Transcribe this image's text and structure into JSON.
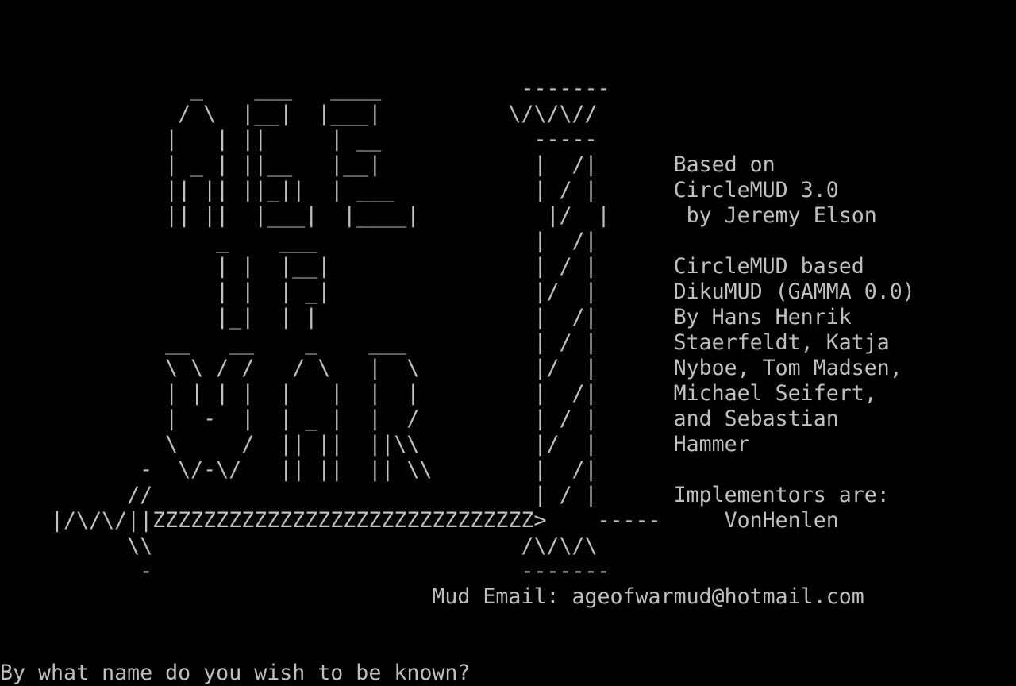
{
  "screen": {
    "background": "#000000",
    "foreground": "#bfbfbf",
    "lines": [
      "",
      "",
      "",
      "               _    ___   ____           -------",
      "              / \\  |__|  |___|          \\/\\/\\//",
      "             |   | ||     | __            -----",
      "             | _ | ||__   |__|            |  /|      Based on",
      "             || || ||_||  | ___           | / |      CircleMUD 3.0",
      "             || ||  |___|  |____|          |/  |      by Jeremy Elson",
      "                 _    ___                 |  /|",
      "                 | |  |__|                | / |      CircleMUD based",
      "                 | |  | _|                |/  |      DikuMUD (GAMMA 0.0)",
      "                 |_|  | |                 |  /|      By Hans Henrik",
      "             __   __    _    ___          | / |      Staerfeldt, Katja",
      "             \\ \\ / /   / \\   |  \\         |/  |      Nyboe, Tom Madsen,",
      "             | | | |  |   |  |  |         |  /|      Michael Seifert,",
      "             |  -  |  | _ |  |  /         | / |      and Sebastian",
      "             \\     /  || ||  ||\\\\         |/  |      Hammer",
      "           -  \\/-\\/   || ||  || \\\\        |  /|",
      "          //                              | / |      Implementors are:",
      "    |/\\/\\/||ZZZZZZZZZZZZZZZZZZZZZZZZZZZZZZ>    -----     VonHenlen",
      "          \\\\                             /\\/\\/\\",
      "           -                             -------",
      "                                  Mud Email: ageofwarmud@hotmail.com",
      "",
      "",
      "By what name do you wish to be known?"
    ]
  }
}
